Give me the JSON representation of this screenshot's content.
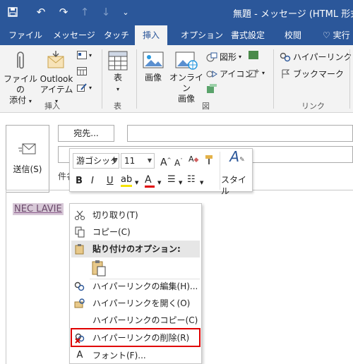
{
  "titlebar": {
    "title": "無題  -  メッセージ (HTML 形式)",
    "quick_access": [
      "save-icon",
      "undo-icon",
      "redo-icon",
      "up-arrow-icon",
      "down-arrow-icon",
      "customize-icon"
    ]
  },
  "tabs": [
    "ファイル",
    "メッセージ",
    "タッチ",
    "挿入",
    "オプション",
    "書式設定",
    "校閲",
    "実行"
  ],
  "active_tab": "挿入",
  "ribbon": {
    "attach_file": "ファイルの\n添付",
    "outlook_item": "Outlook\nアイテム",
    "group_insert": "挿入",
    "table": "表",
    "group_table": "表",
    "picture": "画像",
    "online_picture": "オンライン\n画像",
    "shapes": "図形",
    "icons": "アイコン",
    "group_illustrations": "図",
    "hyperlink": "ハイパーリンク",
    "bookmark": "ブックマーク",
    "group_links": "リンク"
  },
  "message": {
    "send": "送信(S)",
    "to": "宛先...",
    "subject_label": "件名",
    "body_link_text": "NEC LAVIE"
  },
  "minitoolbar": {
    "font": "游ゴシック",
    "size": "11",
    "styles": "スタイル",
    "bold": "B",
    "italic": "I",
    "underline": "U"
  },
  "context_menu": {
    "items": {
      "cut": "切り取り(T)",
      "copy": "コピー(C)",
      "paste_options": "貼り付けのオプション:",
      "edit_link": "ハイパーリンクの編集(H)...",
      "open_link": "ハイパーリンクを開く(O)",
      "copy_link": "ハイパーリンクのコピー(C)",
      "remove_link": "ハイパーリンクの削除(R)",
      "font": "フォント(F)..."
    }
  },
  "colors": {
    "brand": "#2b579a",
    "highlight_border": "#e00000",
    "link_text": "#6b4a6b"
  }
}
